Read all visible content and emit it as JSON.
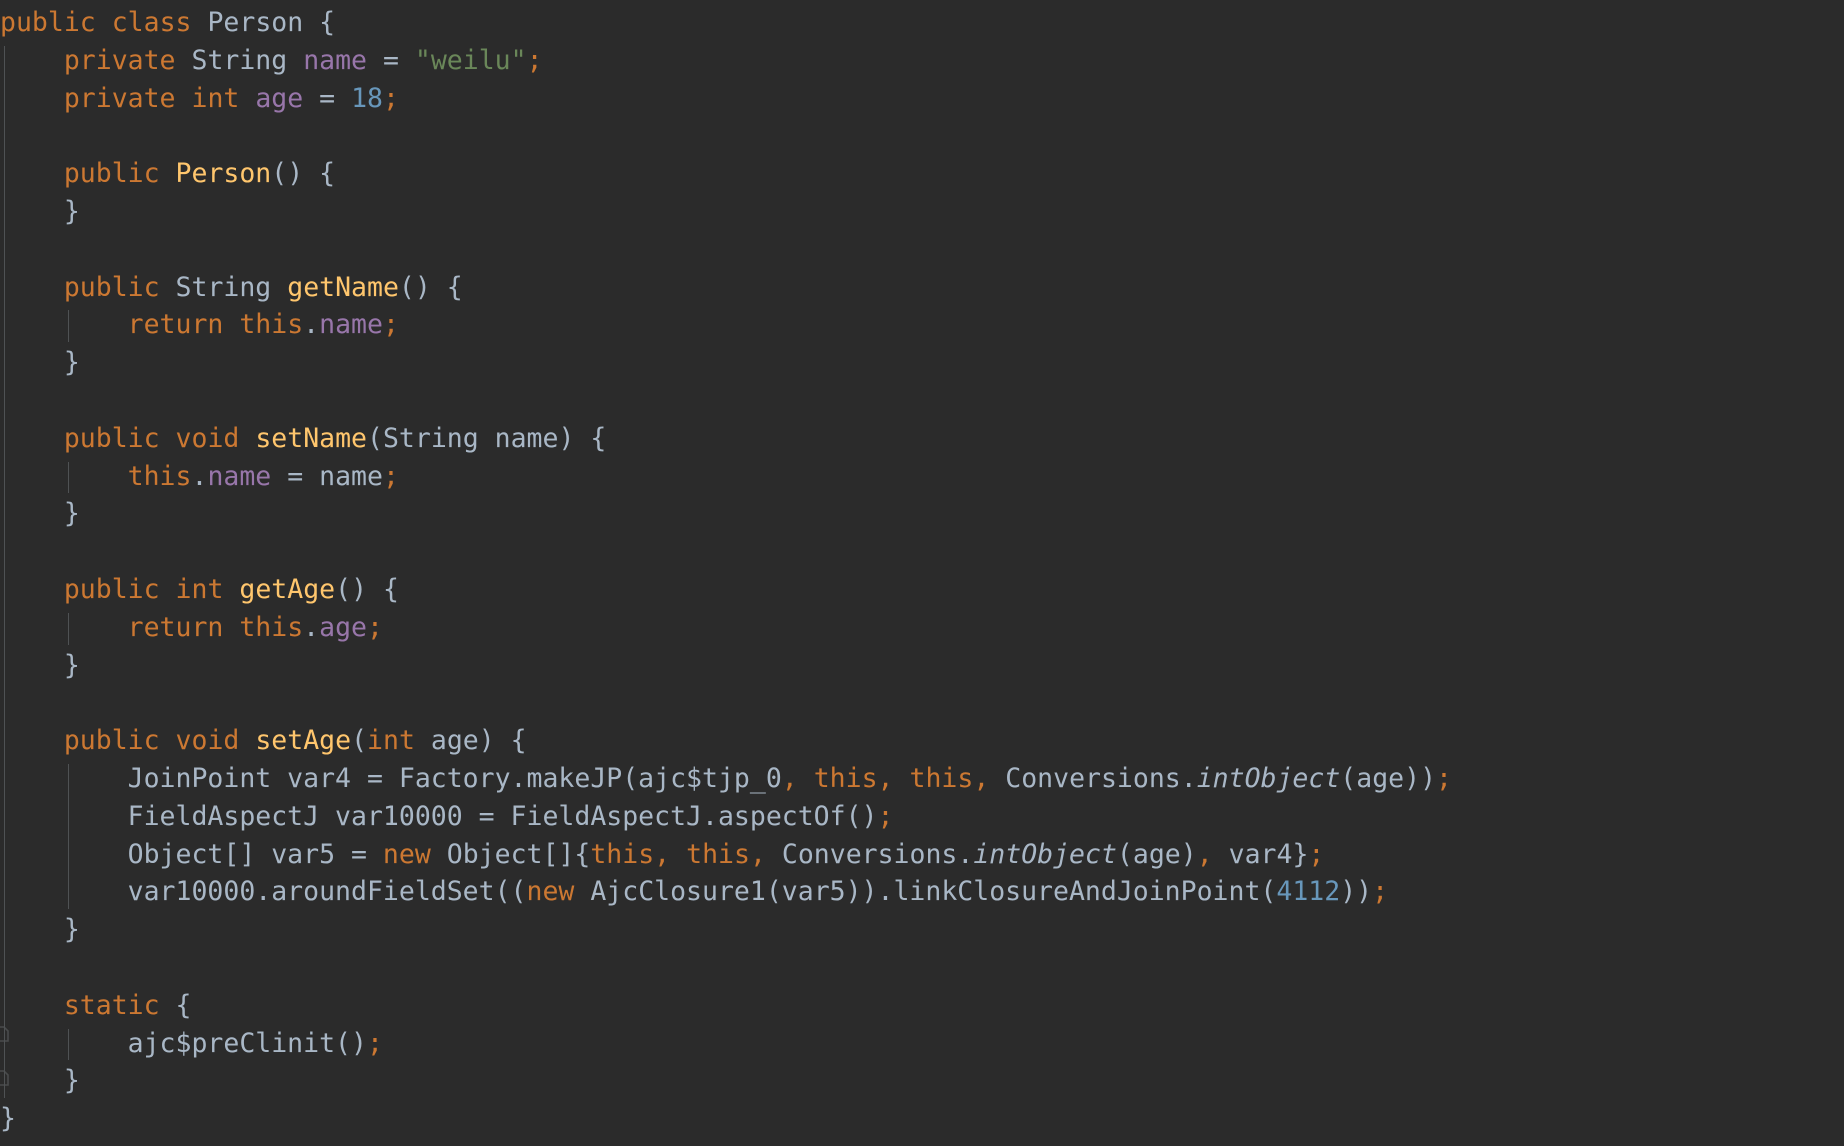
{
  "editor": {
    "language": "java",
    "file_title": "Person",
    "theme": "darcula",
    "background": "#2b2b2b",
    "default_text": "#a9b7c6",
    "colors": {
      "keyword": "#cc7832",
      "method_name": "#ffc66d",
      "field": "#9876aa",
      "string": "#6a8759",
      "number": "#6897bb",
      "identifier": "#a9b7c6",
      "punctuation_accent": "#cc7832",
      "indent_guide": "#4f5254",
      "gutter_icon": "#6e7275"
    },
    "gutter_icons": [
      "class-marker-icon",
      "method-marker-icon"
    ]
  },
  "code": {
    "lines": [
      {
        "n": 1,
        "indent": 0,
        "tokens": [
          {
            "t": "public",
            "c": "kw"
          },
          {
            "t": " ",
            "c": "id"
          },
          {
            "t": "class",
            "c": "kw"
          },
          {
            "t": " ",
            "c": "id"
          },
          {
            "t": "Person",
            "c": "id"
          },
          {
            "t": " {",
            "c": "id"
          }
        ]
      },
      {
        "n": 2,
        "indent": 1,
        "tokens": [
          {
            "t": "private",
            "c": "kw"
          },
          {
            "t": " ",
            "c": "id"
          },
          {
            "t": "String",
            "c": "id"
          },
          {
            "t": " ",
            "c": "id"
          },
          {
            "t": "name",
            "c": "fld"
          },
          {
            "t": " = ",
            "c": "id"
          },
          {
            "t": "\"weilu\"",
            "c": "str"
          },
          {
            "t": ";",
            "c": "semi"
          }
        ]
      },
      {
        "n": 3,
        "indent": 1,
        "tokens": [
          {
            "t": "private",
            "c": "kw"
          },
          {
            "t": " ",
            "c": "id"
          },
          {
            "t": "int",
            "c": "kw"
          },
          {
            "t": " ",
            "c": "id"
          },
          {
            "t": "age",
            "c": "fld"
          },
          {
            "t": " = ",
            "c": "id"
          },
          {
            "t": "18",
            "c": "num"
          },
          {
            "t": ";",
            "c": "semi"
          }
        ]
      },
      {
        "n": 4,
        "indent": 0,
        "tokens": []
      },
      {
        "n": 5,
        "indent": 1,
        "tokens": [
          {
            "t": "public",
            "c": "kw"
          },
          {
            "t": " ",
            "c": "id"
          },
          {
            "t": "Person",
            "c": "meth"
          },
          {
            "t": "() {",
            "c": "id"
          }
        ]
      },
      {
        "n": 6,
        "indent": 1,
        "tokens": [
          {
            "t": "}",
            "c": "id"
          }
        ]
      },
      {
        "n": 7,
        "indent": 0,
        "tokens": []
      },
      {
        "n": 8,
        "indent": 1,
        "tokens": [
          {
            "t": "public",
            "c": "kw"
          },
          {
            "t": " ",
            "c": "id"
          },
          {
            "t": "String",
            "c": "id"
          },
          {
            "t": " ",
            "c": "id"
          },
          {
            "t": "getName",
            "c": "meth"
          },
          {
            "t": "() {",
            "c": "id"
          }
        ]
      },
      {
        "n": 9,
        "indent": 2,
        "tokens": [
          {
            "t": "return",
            "c": "kw"
          },
          {
            "t": " ",
            "c": "id"
          },
          {
            "t": "this",
            "c": "kw"
          },
          {
            "t": ".",
            "c": "id"
          },
          {
            "t": "name",
            "c": "fld"
          },
          {
            "t": ";",
            "c": "semi"
          }
        ]
      },
      {
        "n": 10,
        "indent": 1,
        "tokens": [
          {
            "t": "}",
            "c": "id"
          }
        ]
      },
      {
        "n": 11,
        "indent": 0,
        "tokens": []
      },
      {
        "n": 12,
        "indent": 1,
        "tokens": [
          {
            "t": "public",
            "c": "kw"
          },
          {
            "t": " ",
            "c": "id"
          },
          {
            "t": "void",
            "c": "kw"
          },
          {
            "t": " ",
            "c": "id"
          },
          {
            "t": "setName",
            "c": "meth"
          },
          {
            "t": "(String name) {",
            "c": "id"
          }
        ]
      },
      {
        "n": 13,
        "indent": 2,
        "tokens": [
          {
            "t": "this",
            "c": "kw"
          },
          {
            "t": ".",
            "c": "id"
          },
          {
            "t": "name",
            "c": "fld"
          },
          {
            "t": " = name",
            "c": "id"
          },
          {
            "t": ";",
            "c": "semi"
          }
        ]
      },
      {
        "n": 14,
        "indent": 1,
        "tokens": [
          {
            "t": "}",
            "c": "id"
          }
        ]
      },
      {
        "n": 15,
        "indent": 0,
        "tokens": []
      },
      {
        "n": 16,
        "indent": 1,
        "tokens": [
          {
            "t": "public",
            "c": "kw"
          },
          {
            "t": " ",
            "c": "id"
          },
          {
            "t": "int",
            "c": "kw"
          },
          {
            "t": " ",
            "c": "id"
          },
          {
            "t": "getAge",
            "c": "meth"
          },
          {
            "t": "() {",
            "c": "id"
          }
        ]
      },
      {
        "n": 17,
        "indent": 2,
        "tokens": [
          {
            "t": "return",
            "c": "kw"
          },
          {
            "t": " ",
            "c": "id"
          },
          {
            "t": "this",
            "c": "kw"
          },
          {
            "t": ".",
            "c": "id"
          },
          {
            "t": "age",
            "c": "fld"
          },
          {
            "t": ";",
            "c": "semi"
          }
        ]
      },
      {
        "n": 18,
        "indent": 1,
        "tokens": [
          {
            "t": "}",
            "c": "id"
          }
        ]
      },
      {
        "n": 19,
        "indent": 0,
        "tokens": []
      },
      {
        "n": 20,
        "indent": 1,
        "tokens": [
          {
            "t": "public",
            "c": "kw"
          },
          {
            "t": " ",
            "c": "id"
          },
          {
            "t": "void",
            "c": "kw"
          },
          {
            "t": " ",
            "c": "id"
          },
          {
            "t": "setAge",
            "c": "meth"
          },
          {
            "t": "(",
            "c": "id"
          },
          {
            "t": "int",
            "c": "kw"
          },
          {
            "t": " age) {",
            "c": "id"
          }
        ]
      },
      {
        "n": 21,
        "indent": 2,
        "tokens": [
          {
            "t": "JoinPoint var4 = Factory.makeJP(ajc$tjp_0",
            "c": "id"
          },
          {
            "t": ",",
            "c": "semi"
          },
          {
            "t": " ",
            "c": "id"
          },
          {
            "t": "this",
            "c": "kw"
          },
          {
            "t": ",",
            "c": "semi"
          },
          {
            "t": " ",
            "c": "id"
          },
          {
            "t": "this",
            "c": "kw"
          },
          {
            "t": ",",
            "c": "semi"
          },
          {
            "t": " ",
            "c": "id"
          },
          {
            "t": "Conversions.",
            "c": "id"
          },
          {
            "t": "intObject",
            "c": "stat"
          },
          {
            "t": "(age))",
            "c": "id"
          },
          {
            "t": ";",
            "c": "semi"
          }
        ]
      },
      {
        "n": 22,
        "indent": 2,
        "tokens": [
          {
            "t": "FieldAspectJ var10000 = FieldAspectJ.aspectOf()",
            "c": "id"
          },
          {
            "t": ";",
            "c": "semi"
          }
        ]
      },
      {
        "n": 23,
        "indent": 2,
        "tokens": [
          {
            "t": "Object[] var5 = ",
            "c": "id"
          },
          {
            "t": "new",
            "c": "kw"
          },
          {
            "t": " Object[]{",
            "c": "id"
          },
          {
            "t": "this",
            "c": "kw"
          },
          {
            "t": ",",
            "c": "semi"
          },
          {
            "t": " ",
            "c": "id"
          },
          {
            "t": "this",
            "c": "kw"
          },
          {
            "t": ",",
            "c": "semi"
          },
          {
            "t": " ",
            "c": "id"
          },
          {
            "t": "Conversions.",
            "c": "id"
          },
          {
            "t": "intObject",
            "c": "stat"
          },
          {
            "t": "(age)",
            "c": "id"
          },
          {
            "t": ",",
            "c": "semi"
          },
          {
            "t": " var4}",
            "c": "id"
          },
          {
            "t": ";",
            "c": "semi"
          }
        ]
      },
      {
        "n": 24,
        "indent": 2,
        "tokens": [
          {
            "t": "var10000.aroundFieldSet((",
            "c": "id"
          },
          {
            "t": "new",
            "c": "kw"
          },
          {
            "t": " AjcClosure1(var5)).linkClosureAndJoinPoint(",
            "c": "id"
          },
          {
            "t": "4112",
            "c": "num"
          },
          {
            "t": "))",
            "c": "id"
          },
          {
            "t": ";",
            "c": "semi"
          }
        ]
      },
      {
        "n": 25,
        "indent": 1,
        "tokens": [
          {
            "t": "}",
            "c": "id"
          }
        ]
      },
      {
        "n": 26,
        "indent": 0,
        "tokens": []
      },
      {
        "n": 27,
        "indent": 1,
        "tokens": [
          {
            "t": "static",
            "c": "kw"
          },
          {
            "t": " {",
            "c": "id"
          }
        ]
      },
      {
        "n": 28,
        "indent": 2,
        "tokens": [
          {
            "t": "ajc$preClinit()",
            "c": "id"
          },
          {
            "t": ";",
            "c": "semi"
          }
        ]
      },
      {
        "n": 29,
        "indent": 1,
        "tokens": [
          {
            "t": "}",
            "c": "id"
          }
        ]
      },
      {
        "n": 30,
        "indent": 0,
        "tokens": [
          {
            "t": "}",
            "c": "id"
          }
        ]
      }
    ],
    "plain_text": "public class Person {\n    private String name = \"weilu\";\n    private int age = 18;\n\n    public Person() {\n    }\n\n    public String getName() {\n        return this.name;\n    }\n\n    public void setName(String name) {\n        this.name = name;\n    }\n\n    public int getAge() {\n        return this.age;\n    }\n\n    public void setAge(int age) {\n        JoinPoint var4 = Factory.makeJP(ajc$tjp_0, this, this, Conversions.intObject(age));\n        FieldAspectJ var10000 = FieldAspectJ.aspectOf();\n        Object[] var5 = new Object[]{this, this, Conversions.intObject(age), var4};\n        var10000.aroundFieldSet((new AjcClosure1(var5)).linkClosureAndJoinPoint(4112));\n    }\n\n    static {\n        ajc$preClinit();\n    }\n}"
  }
}
